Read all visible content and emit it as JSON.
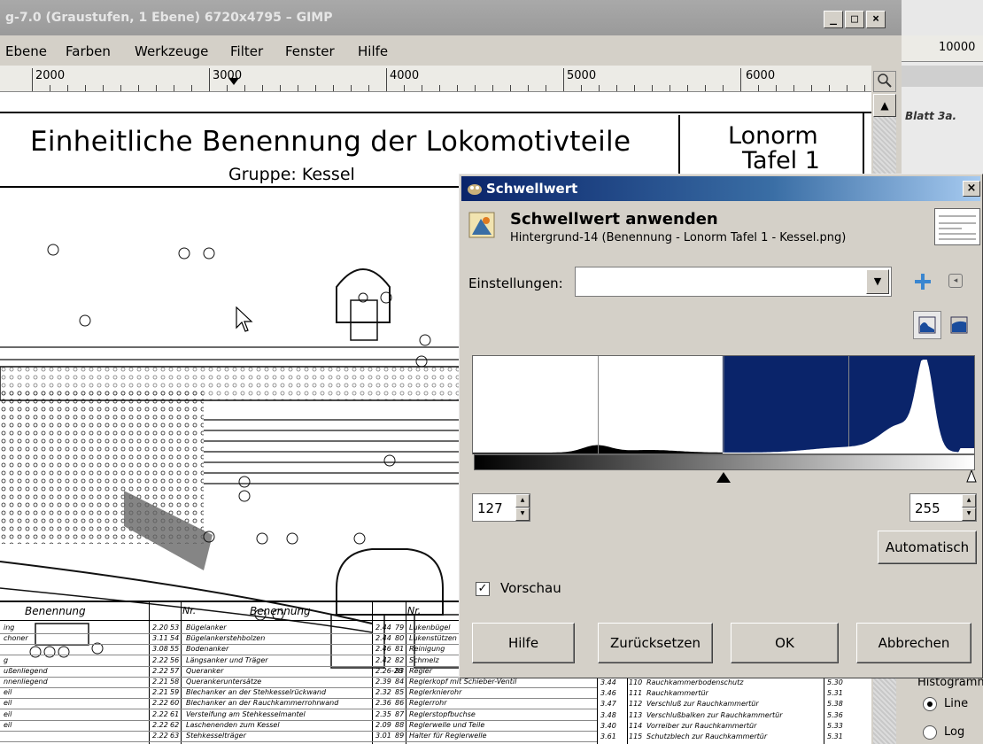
{
  "window": {
    "title": "g-7.0 (Graustufen, 1 Ebene) 6720x4795 – GIMP",
    "buttons": {
      "minimize": "_",
      "maximize": "□",
      "close": "×"
    }
  },
  "menu": [
    {
      "label": "Ebene",
      "underline": "E"
    },
    {
      "label": "Farben",
      "underline": "F"
    },
    {
      "label": "Werkzeuge",
      "underline": "W"
    },
    {
      "label": "Filter",
      "underline": "r"
    },
    {
      "label": "Fenster",
      "underline": "F"
    },
    {
      "label": "Hilfe",
      "underline": "H"
    }
  ],
  "ruler": {
    "labels": [
      "2000",
      "3000",
      "4000",
      "5000",
      "6000"
    ]
  },
  "canvas": {
    "title": "Einheitliche Benennung der Lokomotivteile",
    "subtitle": "Gruppe: Kessel",
    "box_line1": "Lonorm",
    "box_line2": "Tafel 1",
    "table_headers": [
      "Benennung",
      "Nr.",
      "Benennung",
      "Nr."
    ],
    "table_rows": [
      [
        "2.20",
        "53",
        "Bügelanker",
        "2.44",
        "79",
        "Lukenbügel"
      ],
      [
        "3.11",
        "54",
        "Bügelankerstehbolzen",
        "2.44",
        "80",
        "Lukenstützen"
      ],
      [
        "3.08",
        "55",
        "Bodenanker",
        "2.46",
        "81",
        "Reinigung"
      ],
      [
        "2.22",
        "56",
        "Längsanker und Träger",
        "2.42",
        "82",
        "Schmelz"
      ],
      [
        "2.22",
        "57",
        "Queranker",
        "2.26-28",
        "83",
        "Regler"
      ],
      [
        "2.21",
        "58",
        "Querankeruntersätze",
        "2.39",
        "84",
        "Reglerkopf mit Schieber-Ventil"
      ],
      [
        "2.21",
        "59",
        "Blechanker an der Stehkesselrückwand",
        "2.32",
        "85",
        "Reglerknierohr"
      ],
      [
        "2.22",
        "60",
        "Blechanker an der Rauchkammerrohrwand",
        "2.36",
        "86",
        "Reglerrohr"
      ],
      [
        "2.22",
        "61",
        "Versteifung am Stehkesselmantel",
        "2.35",
        "87",
        "Reglerstopfbuchse"
      ],
      [
        "2.22",
        "62",
        "Laschenenden zum Kessel",
        "2.09",
        "88",
        "Reglerwelle und Teile"
      ],
      [
        "2.22",
        "63",
        "Stehkesselträger",
        "3.01",
        "89",
        "Halter für Reglerwelle"
      ]
    ],
    "table_rows_right": [
      [
        "3.44",
        "110",
        "Rauchkammerbodenschutz",
        "5.30"
      ],
      [
        "3.46",
        "111",
        "Rauchkammertür",
        "5.31"
      ],
      [
        "3.47",
        "112",
        "Verschluß zur Rauchkammertür",
        "5.38"
      ],
      [
        "3.48",
        "113",
        "Verschlußbalken zur Rauchkammertür",
        "5.36"
      ],
      [
        "3.40",
        "114",
        "Vorreiber zur Rauchkammertür",
        "5.33"
      ],
      [
        "3.61",
        "115",
        "Schutzblech zur Rauchkammertür",
        "5.31"
      ]
    ],
    "table_left_col": [
      "ing",
      "choner",
      "",
      "g",
      "ußenliegend",
      "nnenliegend",
      "eil",
      "eil",
      "eil",
      "eil"
    ]
  },
  "right_window": {
    "ruler_label": "10000",
    "sheet_label": "Blatt 3a.",
    "panel_title": "Histogramm",
    "radio_linear": "Line",
    "radio_log": "Log"
  },
  "dialog": {
    "title": "Schwellwert",
    "heading": "Schwellwert anwenden",
    "subheading": "Hintergrund-14 (Benennung - Lonorm Tafel 1 - Kessel.png)",
    "settings_label": "Einstellungen:",
    "settings_value": "",
    "low_value": "127",
    "high_value": "255",
    "auto_button": "Automatisch",
    "preview_label": "Vorschau",
    "preview_checked": true,
    "buttons": {
      "help": "Hilfe",
      "reset": "Zurücksetzen",
      "ok": "OK",
      "cancel": "Abbrechen"
    },
    "threshold": {
      "low": 127,
      "high": 255
    },
    "colors": {
      "selection": "#0a246a",
      "title_start": "#0a246a",
      "title_end": "#a6caf0"
    }
  }
}
